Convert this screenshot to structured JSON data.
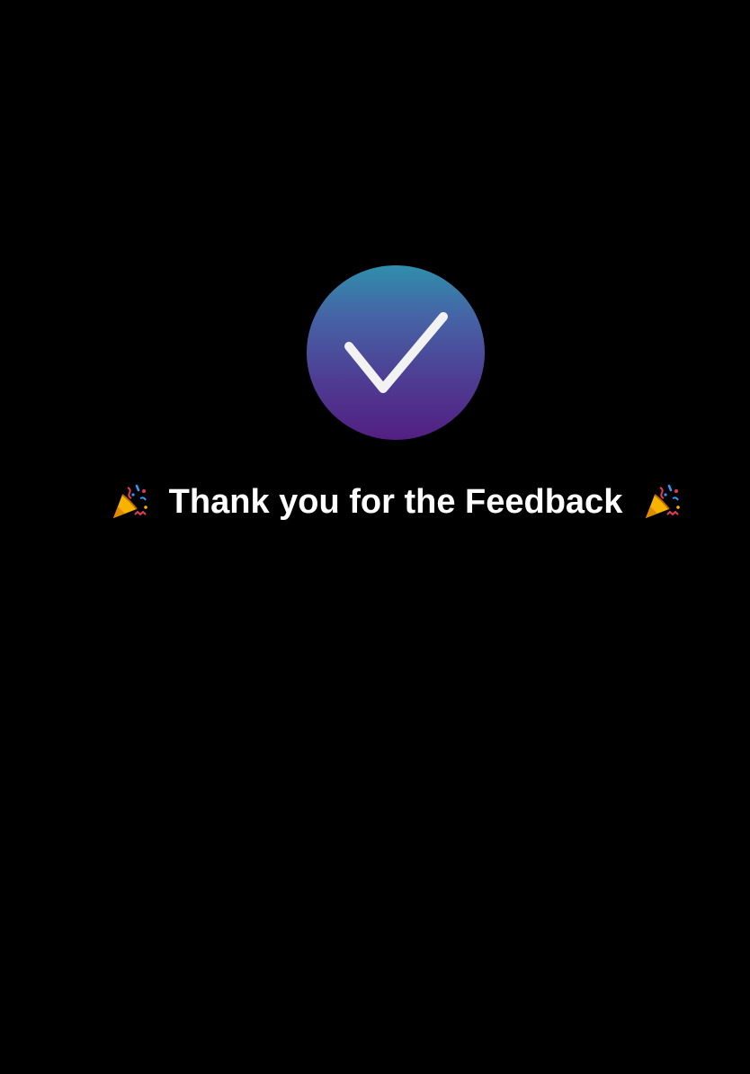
{
  "confirmation": {
    "icon": "checkmark-icon",
    "message": "Thank you for the Feedback",
    "decoration_icon": "party-popper-icon"
  },
  "colors": {
    "background": "#000000",
    "text": "#ffffff",
    "circle_gradient": [
      "#2f8fab",
      "#4663a6",
      "#4e3d93",
      "#521f82"
    ],
    "checkmark": "#f2f2f2"
  }
}
